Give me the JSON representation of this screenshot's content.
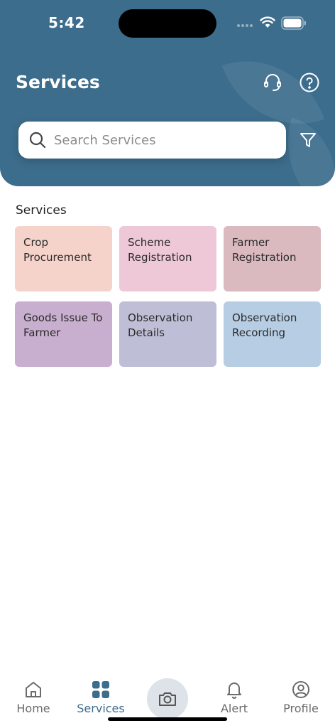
{
  "status_bar": {
    "time": "5:42"
  },
  "header": {
    "title": "Services",
    "support_icon": "headset-icon",
    "help_icon": "help-circle-icon",
    "background_color": "#3d6d8c"
  },
  "search": {
    "placeholder": "Search Services",
    "value": "",
    "search_icon": "search-icon",
    "filter_icon": "filter-icon"
  },
  "services_section": {
    "title": "Services",
    "cards": [
      {
        "label": "Crop Procurement",
        "color": "#f5d3ca"
      },
      {
        "label": "Scheme Registration",
        "color": "#eec8d6"
      },
      {
        "label": "Farmer Registration",
        "color": "#dab9bf"
      },
      {
        "label": "Goods Issue To Farmer",
        "color": "#c8afcf"
      },
      {
        "label": "Observation Details",
        "color": "#bebfd7"
      },
      {
        "label": "Observation Recording",
        "color": "#b7cde3"
      }
    ]
  },
  "bottom_nav": {
    "items": [
      {
        "label": "Home",
        "icon": "home-icon",
        "active": false
      },
      {
        "label": "Services",
        "icon": "grid-icon",
        "active": true
      },
      {
        "label": "Alert",
        "icon": "bell-icon",
        "active": false
      },
      {
        "label": "Profile",
        "icon": "user-circle-icon",
        "active": false
      }
    ],
    "camera_icon": "camera-icon",
    "active_color": "#3d6d8c"
  }
}
